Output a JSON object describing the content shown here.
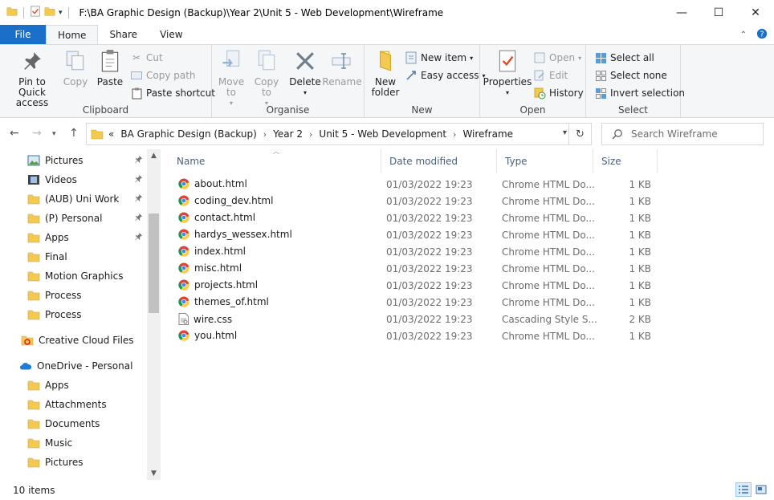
{
  "window": {
    "title": "F:\\BA Graphic Design (Backup)\\Year 2\\Unit 5  - Web Development\\Wireframe",
    "minimize": "—",
    "maximize": "☐",
    "close": "✕"
  },
  "tabs": {
    "file": "File",
    "home": "Home",
    "share": "Share",
    "view": "View"
  },
  "ribbon": {
    "clipboard": {
      "label": "Clipboard",
      "pin": "Pin to Quick access",
      "copy": "Copy",
      "paste": "Paste",
      "cut": "Cut",
      "copy_path": "Copy path",
      "paste_shortcut": "Paste shortcut"
    },
    "organise": {
      "label": "Organise",
      "move_to": "Move to",
      "copy_to": "Copy to",
      "delete": "Delete",
      "rename": "Rename"
    },
    "new": {
      "label": "New",
      "new_folder": "New folder",
      "new_item": "New item",
      "easy_access": "Easy access"
    },
    "open": {
      "label": "Open",
      "properties": "Properties",
      "open": "Open",
      "edit": "Edit",
      "history": "History"
    },
    "select": {
      "label": "Select",
      "select_all": "Select all",
      "select_none": "Select none",
      "invert_selection": "Invert selection"
    }
  },
  "address": {
    "prefix": "«",
    "crumbs": [
      "BA Graphic Design (Backup)",
      "Year 2",
      "Unit 5  - Web Development",
      "Wireframe"
    ],
    "search_placeholder": "Search Wireframe"
  },
  "nav": {
    "items": [
      {
        "label": "Pictures",
        "icon": "pictures-icon",
        "pinned": true
      },
      {
        "label": "Videos",
        "icon": "videos-icon",
        "pinned": true
      },
      {
        "label": "(AUB) Uni Work",
        "icon": "folder-icon",
        "pinned": true
      },
      {
        "label": "(P) Personal",
        "icon": "folder-icon",
        "pinned": true
      },
      {
        "label": "Apps",
        "icon": "folder-icon",
        "pinned": true
      },
      {
        "label": "Final",
        "icon": "folder-icon",
        "pinned": false
      },
      {
        "label": "Motion Graphics",
        "icon": "folder-icon",
        "pinned": false
      },
      {
        "label": "Process",
        "icon": "folder-icon",
        "pinned": false
      },
      {
        "label": "Process",
        "icon": "folder-icon",
        "pinned": false
      }
    ],
    "creative_cloud": "Creative Cloud Files",
    "onedrive": "OneDrive - Personal",
    "onedrive_items": [
      "Apps",
      "Attachments",
      "Documents",
      "Music",
      "Pictures"
    ]
  },
  "columns": {
    "name": "Name",
    "date": "Date modified",
    "type": "Type",
    "size": "Size"
  },
  "files": [
    {
      "name": "about.html",
      "date": "01/03/2022 19:23",
      "type": "Chrome HTML Do...",
      "size": "1 KB",
      "icon": "chrome-icon"
    },
    {
      "name": "coding_dev.html",
      "date": "01/03/2022 19:23",
      "type": "Chrome HTML Do...",
      "size": "1 KB",
      "icon": "chrome-icon"
    },
    {
      "name": "contact.html",
      "date": "01/03/2022 19:23",
      "type": "Chrome HTML Do...",
      "size": "1 KB",
      "icon": "chrome-icon"
    },
    {
      "name": "hardys_wessex.html",
      "date": "01/03/2022 19:23",
      "type": "Chrome HTML Do...",
      "size": "1 KB",
      "icon": "chrome-icon"
    },
    {
      "name": "index.html",
      "date": "01/03/2022 19:23",
      "type": "Chrome HTML Do...",
      "size": "1 KB",
      "icon": "chrome-icon"
    },
    {
      "name": "misc.html",
      "date": "01/03/2022 19:23",
      "type": "Chrome HTML Do...",
      "size": "1 KB",
      "icon": "chrome-icon"
    },
    {
      "name": "projects.html",
      "date": "01/03/2022 19:23",
      "type": "Chrome HTML Do...",
      "size": "1 KB",
      "icon": "chrome-icon"
    },
    {
      "name": "themes_of.html",
      "date": "01/03/2022 19:23",
      "type": "Chrome HTML Do...",
      "size": "1 KB",
      "icon": "chrome-icon"
    },
    {
      "name": "wire.css",
      "date": "01/03/2022 19:23",
      "type": "Cascading Style S...",
      "size": "2 KB",
      "icon": "css-file-icon"
    },
    {
      "name": "you.html",
      "date": "01/03/2022 19:23",
      "type": "Chrome HTML Do...",
      "size": "1 KB",
      "icon": "chrome-icon"
    }
  ],
  "status": {
    "count": "10 items"
  },
  "colors": {
    "accent": "#1a6fc9",
    "folder": "#f3c94f",
    "header_text": "#4c607a"
  }
}
